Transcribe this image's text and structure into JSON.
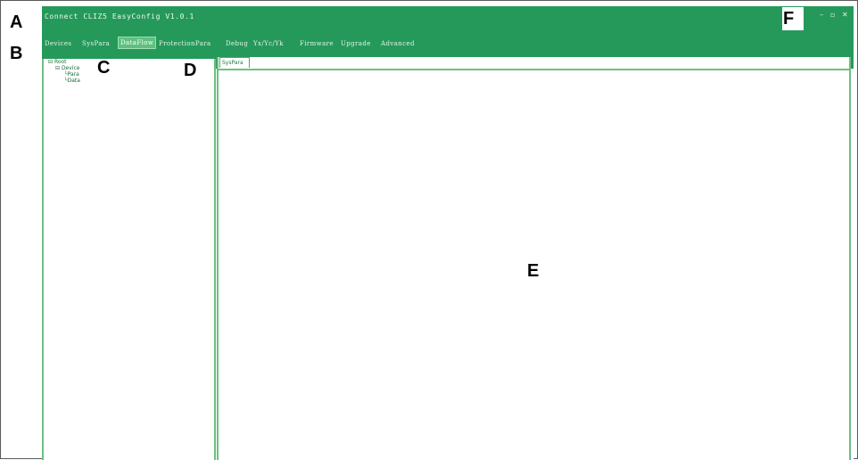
{
  "labels": {
    "a": "A",
    "b": "B",
    "c": "C",
    "d": "D",
    "e": "E",
    "f": "F"
  },
  "window": {
    "title": "Connect CLIZ5 EasyConfig V1.0.1",
    "controls": {
      "minimize": "–",
      "maximize": "▫",
      "close": "✕"
    }
  },
  "menu": {
    "items": [
      "Devices",
      "SysPara",
      "DataFlow",
      "ProtectionPara",
      "Debug",
      "Yx/Yc/Yk",
      "Firmware",
      "Upgrade",
      "Advanced"
    ],
    "active_index": 2
  },
  "tree": {
    "root": "Root",
    "child": "Device",
    "leaves": [
      "Para",
      "Data"
    ]
  },
  "tab": {
    "label": "SysPara"
  },
  "colors": {
    "accent": "#25995a",
    "active_menu": "#5fc07f",
    "panel_border": "#6cbf82"
  }
}
